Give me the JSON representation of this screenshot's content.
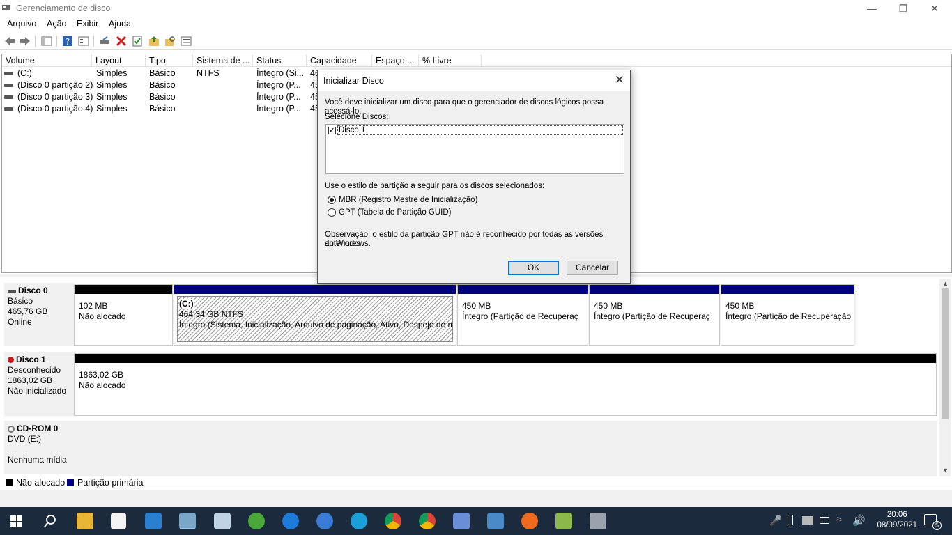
{
  "window": {
    "title": "Gerenciamento de disco"
  },
  "menu": [
    "Arquivo",
    "Ação",
    "Exibir",
    "Ajuda"
  ],
  "volume_list": {
    "headers": [
      "Volume",
      "Layout",
      "Tipo",
      "Sistema de ...",
      "Status",
      "Capacidade",
      "Espaço ...",
      "% Livre"
    ],
    "rows": [
      {
        "volume": "(C:)",
        "layout": "Simples",
        "tipo": "Básico",
        "fs": "NTFS",
        "status": "Íntegro (Si...",
        "cap": "46"
      },
      {
        "volume": "(Disco 0 partição 2)",
        "layout": "Simples",
        "tipo": "Básico",
        "fs": "",
        "status": "Íntegro (P...",
        "cap": "45"
      },
      {
        "volume": "(Disco 0 partição 3)",
        "layout": "Simples",
        "tipo": "Básico",
        "fs": "",
        "status": "Íntegro (P...",
        "cap": "45"
      },
      {
        "volume": "(Disco 0 partição 4)",
        "layout": "Simples",
        "tipo": "Básico",
        "fs": "",
        "status": "Íntegro (P...",
        "cap": "45"
      }
    ]
  },
  "disks": [
    {
      "name": "Disco 0",
      "type": "Básico",
      "size": "465,76 GB",
      "state": "Online",
      "partitions": [
        {
          "l1": "102 MB",
          "l2": "Não alocado"
        },
        {
          "l0": "(C:)",
          "l1": "464,34 GB NTFS",
          "l2": "Íntegro (Sistema, Inicialização, Arquivo de paginação, Ativo, Despejo de m"
        },
        {
          "l1": "450 MB",
          "l2": "Íntegro (Partição de Recuperaç"
        },
        {
          "l1": "450 MB",
          "l2": "Íntegro (Partição de Recuperaç"
        },
        {
          "l1": "450 MB",
          "l2": "Íntegro (Partição de Recuperação)"
        }
      ]
    },
    {
      "name": "Disco 1",
      "type": "Desconhecido",
      "size": "1863,02 GB",
      "state": "Não inicializado",
      "partitions": [
        {
          "l1": "1863,02 GB",
          "l2": "Não alocado"
        }
      ]
    },
    {
      "name": "CD-ROM 0",
      "type": "DVD (E:)",
      "size": "",
      "state": "Nenhuma mídia"
    }
  ],
  "legend": {
    "unallocated": "Não alocado",
    "primary": "Partição primária"
  },
  "dialog": {
    "title": "Inicializar Disco",
    "intro": "Você deve inicializar um disco para que o gerenciador de discos lógicos possa acessá-lo.",
    "select_label": "Selecione Discos:",
    "disk_item": "Disco 1",
    "style_label": "Use o estilo de partição a seguir para os discos selecionados:",
    "mbr": "MBR (Registro Mestre de Inicialização)",
    "gpt": "GPT (Tabela de Partição GUID)",
    "note_line1": "Observação: o estilo da partição GPT não é reconhecido por todas as versões anteriores",
    "note_line2": "do Windows.",
    "ok": "OK",
    "cancel": "Cancelar"
  },
  "taskbar": {
    "time": "20:06",
    "date": "08/09/2021",
    "notifications": "5"
  },
  "colors": {
    "primary_partition": "#000080",
    "unallocated": "#000000",
    "taskbar": "#1c2a3d",
    "accent": "#0078d7"
  }
}
